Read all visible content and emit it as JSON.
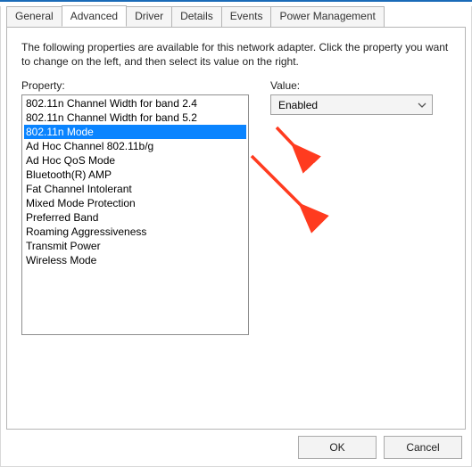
{
  "tabs": {
    "items": [
      {
        "label": "General"
      },
      {
        "label": "Advanced"
      },
      {
        "label": "Driver"
      },
      {
        "label": "Details"
      },
      {
        "label": "Events"
      },
      {
        "label": "Power Management"
      }
    ],
    "active_index": 1
  },
  "panel": {
    "description": "The following properties are available for this network adapter. Click the property you want to change on the left, and then select its value on the right."
  },
  "property": {
    "label": "Property:",
    "items": [
      "802.11n Channel Width for band 2.4",
      "802.11n Channel Width for band 5.2",
      "802.11n Mode",
      "Ad Hoc Channel 802.11b/g",
      "Ad Hoc QoS Mode",
      "Bluetooth(R) AMP",
      "Fat Channel Intolerant",
      "Mixed Mode Protection",
      "Preferred Band",
      "Roaming Aggressiveness",
      "Transmit Power",
      "Wireless Mode"
    ],
    "selected_index": 2
  },
  "value": {
    "label": "Value:",
    "selected": "Enabled"
  },
  "buttons": {
    "ok": "OK",
    "cancel": "Cancel"
  },
  "colors": {
    "selection": "#0a84ff",
    "annotation": "#ff3b1f",
    "topbar": "#1a6bb8"
  }
}
